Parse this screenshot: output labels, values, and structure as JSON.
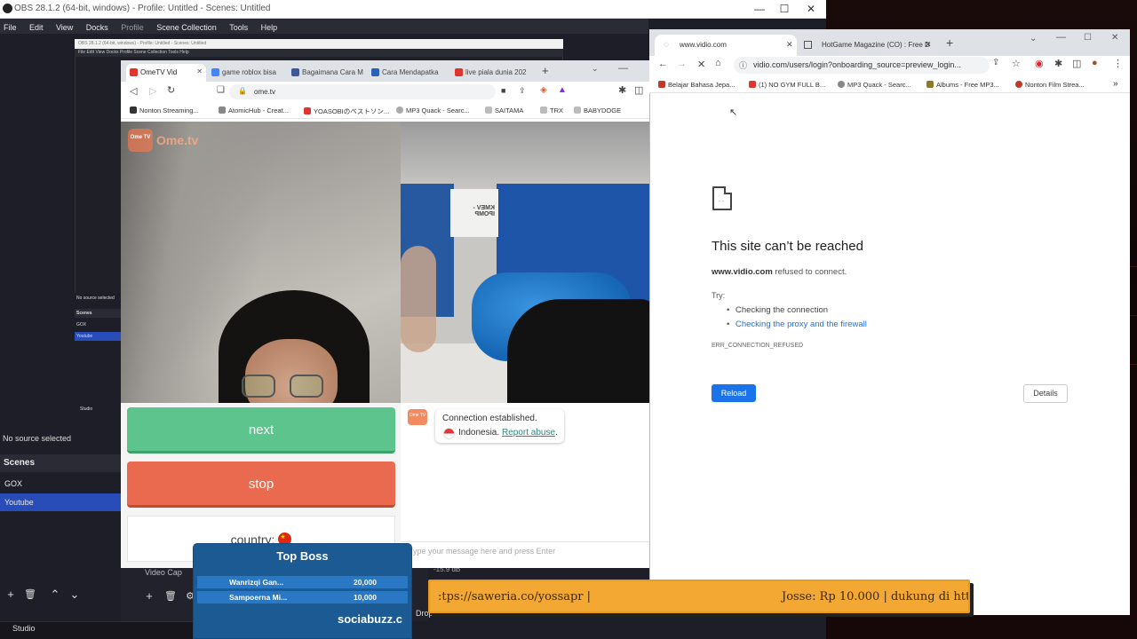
{
  "obs": {
    "title": "OBS 28.1.2 (64-bit, windows) - Profile: Untitled - Scenes: Untitled",
    "menu": [
      "File",
      "Edit",
      "View",
      "Docks",
      "Profile",
      "Scene Collection",
      "Tools",
      "Help"
    ],
    "no_source": "No source selected",
    "scenes_header": "Scenes",
    "scenes": [
      "GOX",
      "Youtube"
    ],
    "active_scene": "Youtube",
    "studio_label": "Studio",
    "video_capture": "Video Cap",
    "db_label": "-15.9 dB",
    "drop_label": "Drop",
    "nested_title": "OBS 28.1.2 (64-bit, windows) - Profile: Untitled - Scenes: Untitled",
    "nested_menu": "File   Edit   View   Docks   Profile   Scene Collection   Tools   Help",
    "nested_no_source": "No source selected",
    "nested_scenes": "Scenes",
    "nested_scene_1": "GOX",
    "nested_scene_2": "Youtube",
    "nested_studio": "Studio"
  },
  "chrome1": {
    "tabs": [
      {
        "label": "OmeTV Vid",
        "color": "#e0342c"
      },
      {
        "label": "game roblox bisa",
        "color": "#4285f4"
      },
      {
        "label": "Bagaimana Cara M",
        "color": "#3b5998"
      },
      {
        "label": "Cara Mendapatka",
        "color": "#2a60b8"
      },
      {
        "label": "live piala dunia 202",
        "color": "#e0342c"
      }
    ],
    "url": "ome.tv",
    "bookmarks": [
      {
        "label": "Nonton Streaming...",
        "color": "#333"
      },
      {
        "label": "AtomicHub - Creat...",
        "color": "#888"
      },
      {
        "label": "YOASOBIのベストソン...",
        "color": "#e0342c"
      },
      {
        "label": "MP3 Quack - Searc...",
        "color": "#aaa"
      },
      {
        "label": "SAITAMA",
        "color": "#bbb"
      },
      {
        "label": "TRX",
        "color": "#bbb"
      },
      {
        "label": "BABYDOGE",
        "color": "#bbb"
      }
    ]
  },
  "ometv": {
    "logo_box": "Ome TV",
    "logo_text": "Ome.tv",
    "next": "next",
    "stop": "stop",
    "country": "country:",
    "avatar_text": "Ome TV",
    "connection": "Connection established.",
    "country_name": "Indonesia.",
    "report": "Report abuse",
    "report_dot": ".",
    "chat_placeholder": "Type your message here and press Enter",
    "sign_text": "KMEV - IPOMP"
  },
  "chrome2": {
    "tabs": [
      {
        "label": "www.vidio.com"
      },
      {
        "label": "HotGame Magazine (CO) : Free D"
      }
    ],
    "url": "vidio.com/users/login?onboarding_source=preview_login...",
    "bookmarks": [
      {
        "label": "Belajar Bahasa Jepa...",
        "color": "#c0392b"
      },
      {
        "label": "(1) NO GYM FULL B...",
        "color": "#e0342c"
      },
      {
        "label": "MP3 Quack - Searc...",
        "color": "#888"
      },
      {
        "label": "Albums - Free MP3...",
        "color": "#8a7a2a"
      },
      {
        "label": "Nonton Film Strea...",
        "color": "#c0392b"
      }
    ],
    "more": "»"
  },
  "error": {
    "title": "This site can’t be reached",
    "domain": "www.vidio.com",
    "refused": " refused to connect.",
    "try": "Try:",
    "suggestions": [
      "Checking the connection",
      "Checking the proxy and the firewall"
    ],
    "code": "ERR_CONNECTION_REFUSED",
    "reload": "Reload",
    "details": "Details"
  },
  "topboss": {
    "title": "Top Boss",
    "rows": [
      {
        "name": "Wanrizqi Gan...",
        "amount": "20,000"
      },
      {
        "name": "Sampoerna Mi...",
        "amount": "10,000"
      }
    ],
    "brand": "sociabuzz.c"
  },
  "ticker": {
    "left": ":tps://saweria.co/yossapr |",
    "right": "Josse: Rp 10.000 |     dukung di htt"
  },
  "colors": {
    "obs_bg": "#1e1e28",
    "scene_active": "#284cb8",
    "next_green": "#5cc48c",
    "stop_red": "#e96a4f",
    "reload_blue": "#1a73e8",
    "ticker": "#f2a833",
    "topboss": "#1b5a93"
  }
}
